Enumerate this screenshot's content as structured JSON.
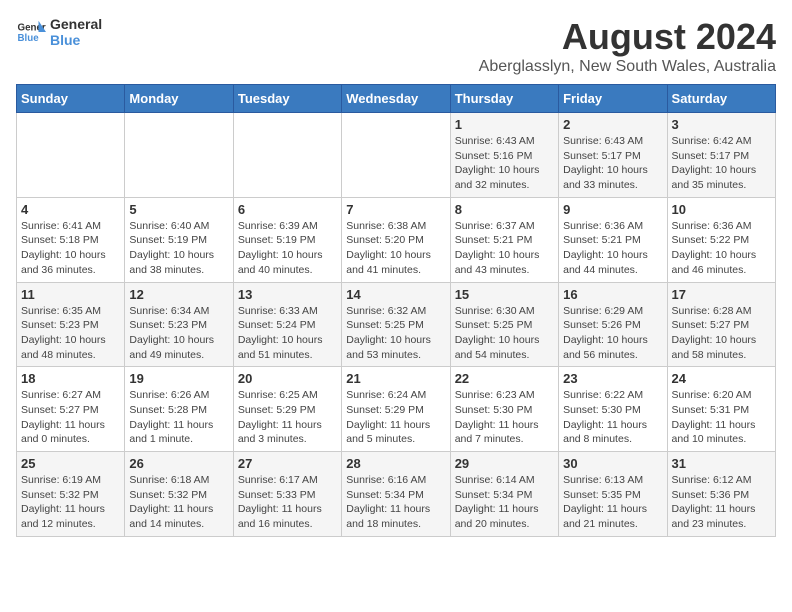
{
  "logo": {
    "text_general": "General",
    "text_blue": "Blue"
  },
  "title": "August 2024",
  "subtitle": "Aberglasslyn, New South Wales, Australia",
  "days_of_week": [
    "Sunday",
    "Monday",
    "Tuesday",
    "Wednesday",
    "Thursday",
    "Friday",
    "Saturday"
  ],
  "weeks": [
    [
      {
        "day": "",
        "info": ""
      },
      {
        "day": "",
        "info": ""
      },
      {
        "day": "",
        "info": ""
      },
      {
        "day": "",
        "info": ""
      },
      {
        "day": "1",
        "info": "Sunrise: 6:43 AM\nSunset: 5:16 PM\nDaylight: 10 hours\nand 32 minutes."
      },
      {
        "day": "2",
        "info": "Sunrise: 6:43 AM\nSunset: 5:17 PM\nDaylight: 10 hours\nand 33 minutes."
      },
      {
        "day": "3",
        "info": "Sunrise: 6:42 AM\nSunset: 5:17 PM\nDaylight: 10 hours\nand 35 minutes."
      }
    ],
    [
      {
        "day": "4",
        "info": "Sunrise: 6:41 AM\nSunset: 5:18 PM\nDaylight: 10 hours\nand 36 minutes."
      },
      {
        "day": "5",
        "info": "Sunrise: 6:40 AM\nSunset: 5:19 PM\nDaylight: 10 hours\nand 38 minutes."
      },
      {
        "day": "6",
        "info": "Sunrise: 6:39 AM\nSunset: 5:19 PM\nDaylight: 10 hours\nand 40 minutes."
      },
      {
        "day": "7",
        "info": "Sunrise: 6:38 AM\nSunset: 5:20 PM\nDaylight: 10 hours\nand 41 minutes."
      },
      {
        "day": "8",
        "info": "Sunrise: 6:37 AM\nSunset: 5:21 PM\nDaylight: 10 hours\nand 43 minutes."
      },
      {
        "day": "9",
        "info": "Sunrise: 6:36 AM\nSunset: 5:21 PM\nDaylight: 10 hours\nand 44 minutes."
      },
      {
        "day": "10",
        "info": "Sunrise: 6:36 AM\nSunset: 5:22 PM\nDaylight: 10 hours\nand 46 minutes."
      }
    ],
    [
      {
        "day": "11",
        "info": "Sunrise: 6:35 AM\nSunset: 5:23 PM\nDaylight: 10 hours\nand 48 minutes."
      },
      {
        "day": "12",
        "info": "Sunrise: 6:34 AM\nSunset: 5:23 PM\nDaylight: 10 hours\nand 49 minutes."
      },
      {
        "day": "13",
        "info": "Sunrise: 6:33 AM\nSunset: 5:24 PM\nDaylight: 10 hours\nand 51 minutes."
      },
      {
        "day": "14",
        "info": "Sunrise: 6:32 AM\nSunset: 5:25 PM\nDaylight: 10 hours\nand 53 minutes."
      },
      {
        "day": "15",
        "info": "Sunrise: 6:30 AM\nSunset: 5:25 PM\nDaylight: 10 hours\nand 54 minutes."
      },
      {
        "day": "16",
        "info": "Sunrise: 6:29 AM\nSunset: 5:26 PM\nDaylight: 10 hours\nand 56 minutes."
      },
      {
        "day": "17",
        "info": "Sunrise: 6:28 AM\nSunset: 5:27 PM\nDaylight: 10 hours\nand 58 minutes."
      }
    ],
    [
      {
        "day": "18",
        "info": "Sunrise: 6:27 AM\nSunset: 5:27 PM\nDaylight: 11 hours\nand 0 minutes."
      },
      {
        "day": "19",
        "info": "Sunrise: 6:26 AM\nSunset: 5:28 PM\nDaylight: 11 hours\nand 1 minute."
      },
      {
        "day": "20",
        "info": "Sunrise: 6:25 AM\nSunset: 5:29 PM\nDaylight: 11 hours\nand 3 minutes."
      },
      {
        "day": "21",
        "info": "Sunrise: 6:24 AM\nSunset: 5:29 PM\nDaylight: 11 hours\nand 5 minutes."
      },
      {
        "day": "22",
        "info": "Sunrise: 6:23 AM\nSunset: 5:30 PM\nDaylight: 11 hours\nand 7 minutes."
      },
      {
        "day": "23",
        "info": "Sunrise: 6:22 AM\nSunset: 5:30 PM\nDaylight: 11 hours\nand 8 minutes."
      },
      {
        "day": "24",
        "info": "Sunrise: 6:20 AM\nSunset: 5:31 PM\nDaylight: 11 hours\nand 10 minutes."
      }
    ],
    [
      {
        "day": "25",
        "info": "Sunrise: 6:19 AM\nSunset: 5:32 PM\nDaylight: 11 hours\nand 12 minutes."
      },
      {
        "day": "26",
        "info": "Sunrise: 6:18 AM\nSunset: 5:32 PM\nDaylight: 11 hours\nand 14 minutes."
      },
      {
        "day": "27",
        "info": "Sunrise: 6:17 AM\nSunset: 5:33 PM\nDaylight: 11 hours\nand 16 minutes."
      },
      {
        "day": "28",
        "info": "Sunrise: 6:16 AM\nSunset: 5:34 PM\nDaylight: 11 hours\nand 18 minutes."
      },
      {
        "day": "29",
        "info": "Sunrise: 6:14 AM\nSunset: 5:34 PM\nDaylight: 11 hours\nand 20 minutes."
      },
      {
        "day": "30",
        "info": "Sunrise: 6:13 AM\nSunset: 5:35 PM\nDaylight: 11 hours\nand 21 minutes."
      },
      {
        "day": "31",
        "info": "Sunrise: 6:12 AM\nSunset: 5:36 PM\nDaylight: 11 hours\nand 23 minutes."
      }
    ]
  ]
}
